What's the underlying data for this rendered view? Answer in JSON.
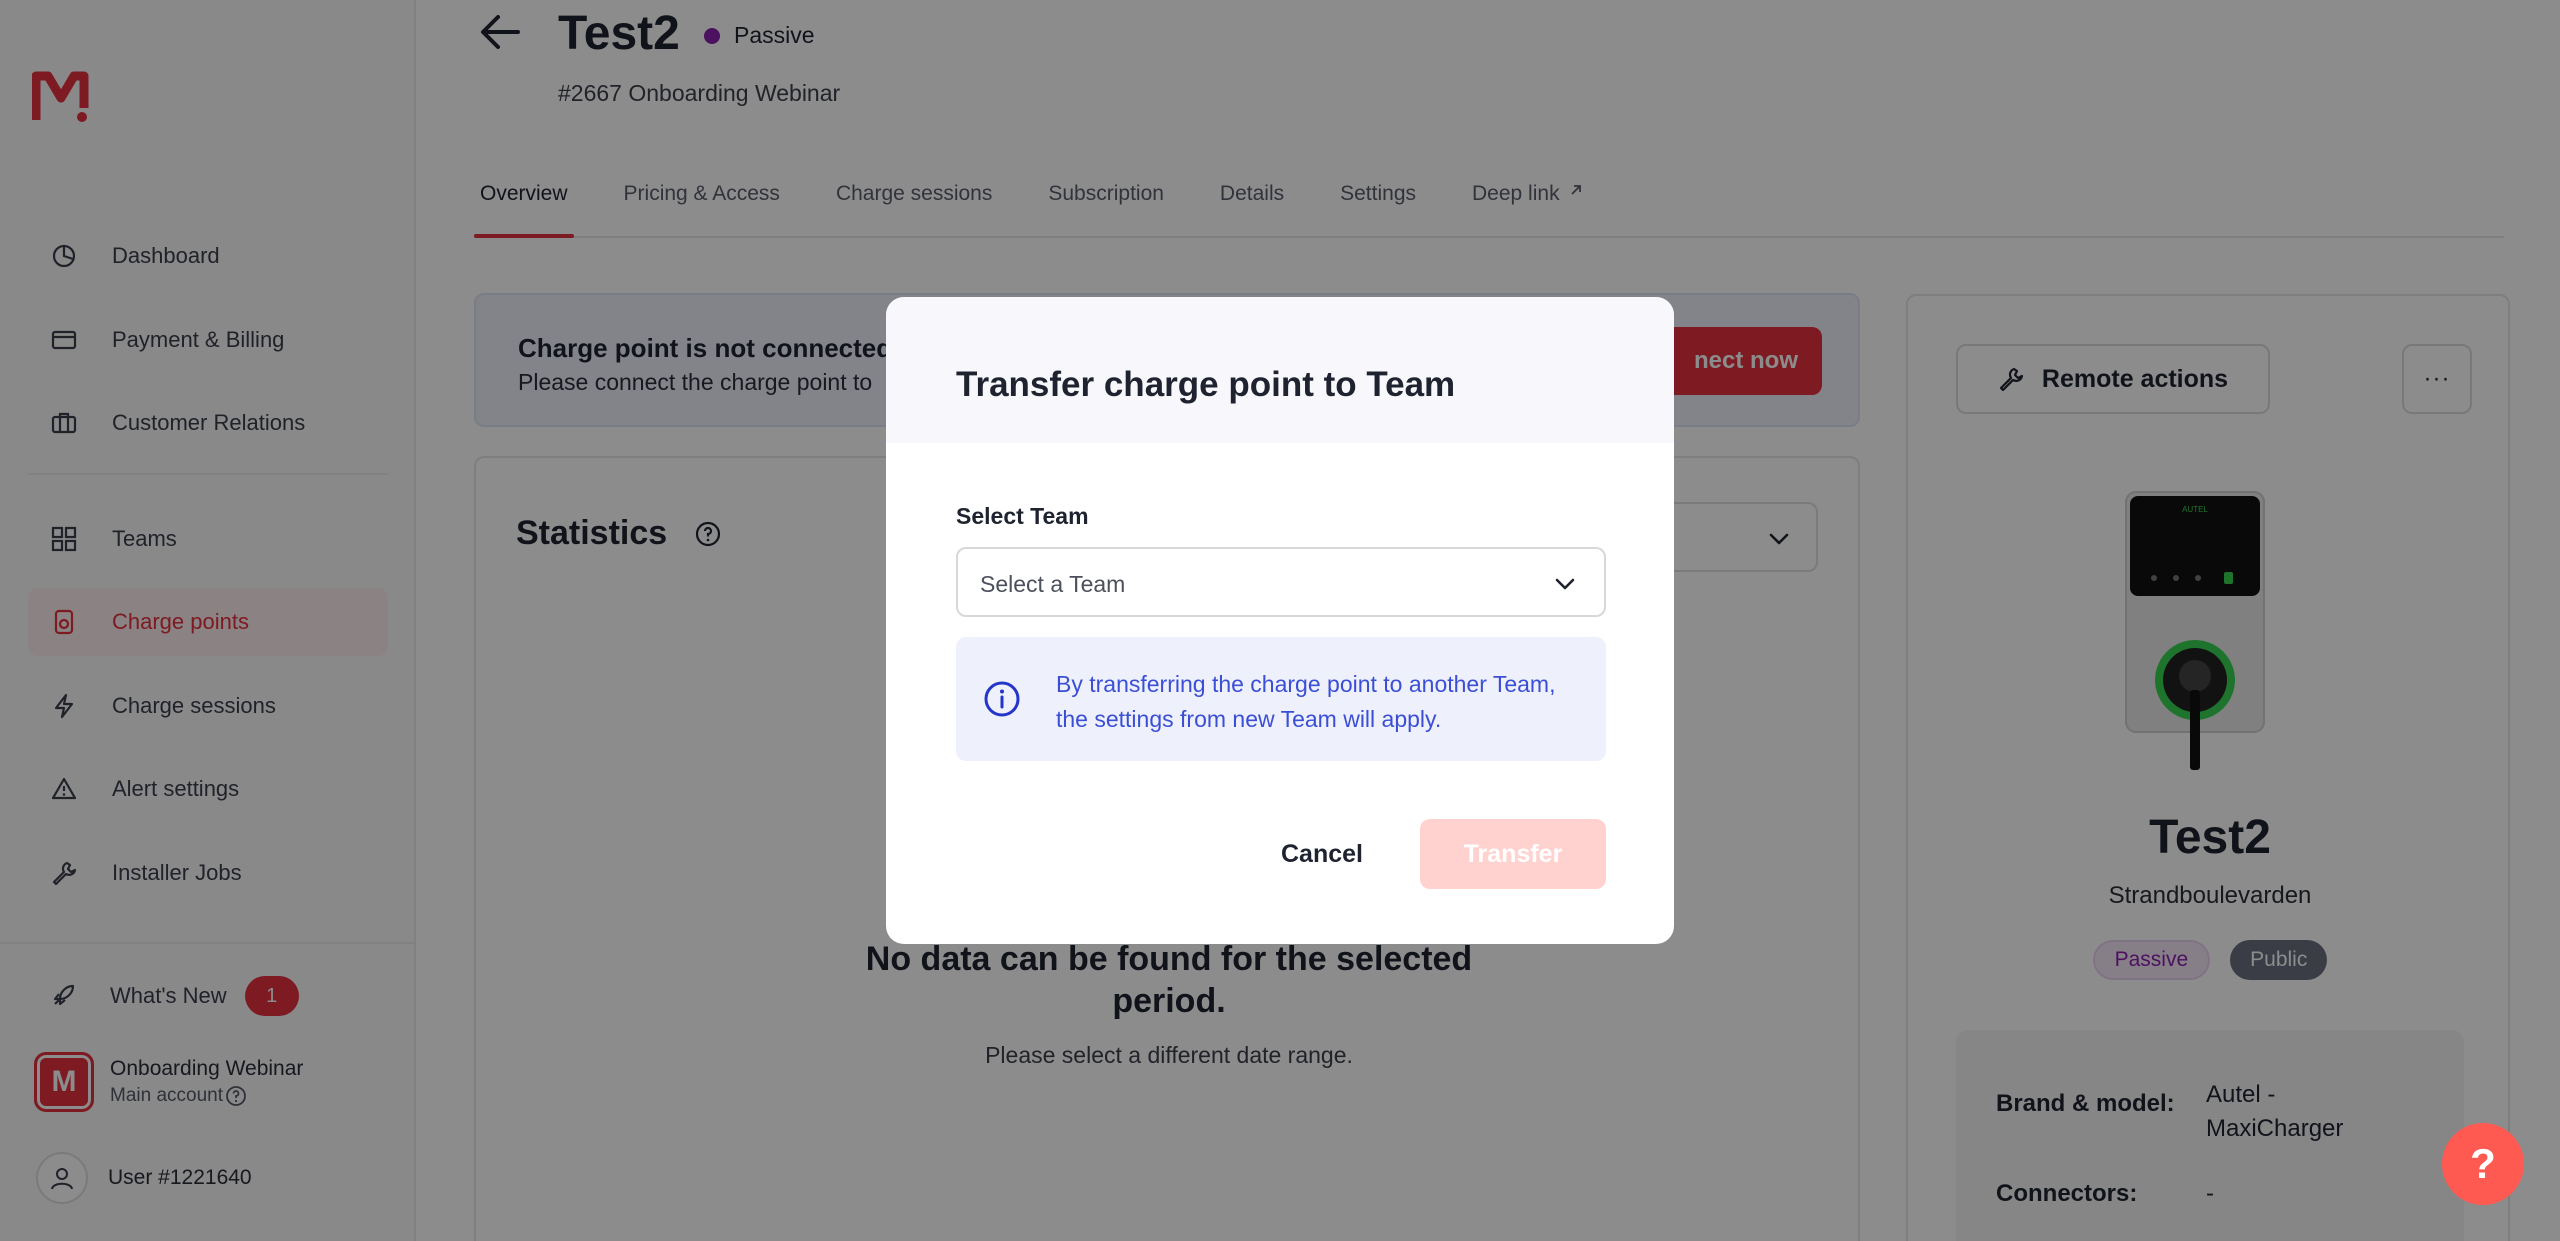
{
  "brand": {
    "logo_letter": "M",
    "accent": "#e3303f"
  },
  "sidebar": {
    "items": [
      {
        "label": "Dashboard",
        "icon": "pie-chart-icon"
      },
      {
        "label": "Payment & Billing",
        "icon": "credit-card-icon"
      },
      {
        "label": "Customer Relations",
        "icon": "briefcase-icon"
      },
      {
        "label": "Teams",
        "icon": "grid-icon"
      },
      {
        "label": "Charge points",
        "icon": "charge-point-icon",
        "active": true
      },
      {
        "label": "Charge sessions",
        "icon": "bolt-icon"
      },
      {
        "label": "Alert settings",
        "icon": "alert-triangle-icon"
      },
      {
        "label": "Installer Jobs",
        "icon": "wrench-icon"
      }
    ],
    "whats_new": {
      "label": "What's New",
      "count": "1"
    },
    "account": {
      "name": "Onboarding Webinar",
      "sub": "Main account",
      "avatar_letter": "M"
    },
    "user": {
      "label": "User #1221640"
    }
  },
  "header": {
    "title": "Test2",
    "status": "Passive",
    "subtitle": "#2667 Onboarding Webinar"
  },
  "tabs": [
    {
      "label": "Overview",
      "active": true
    },
    {
      "label": "Pricing & Access"
    },
    {
      "label": "Charge sessions"
    },
    {
      "label": "Subscription"
    },
    {
      "label": "Details"
    },
    {
      "label": "Settings"
    },
    {
      "label": "Deep link"
    }
  ],
  "alert": {
    "title": "Charge point is not connected",
    "text": "Please connect the charge point to",
    "button": "nect now"
  },
  "statistics": {
    "title": "Statistics",
    "nodata_title": "No data can be found for the selected period.",
    "nodata_sub": "Please select a different date range."
  },
  "right_panel": {
    "remote_actions": "Remote actions",
    "more": "···",
    "name": "Test2",
    "address": "Strandboulevarden",
    "pill_status": "Passive",
    "pill_visibility": "Public",
    "charger_brand_text": "AUTEL",
    "brand_model_label": "Brand & model:",
    "brand_model_value": "Autel - MaxiCharger",
    "connectors_label": "Connectors:",
    "connectors_value": "-"
  },
  "modal": {
    "title": "Transfer charge point to Team",
    "field_label": "Select Team",
    "placeholder": "Select a Team",
    "note": "By transferring the charge point to another Team, the settings from new Team will apply.",
    "cancel": "Cancel",
    "transfer": "Transfer"
  },
  "help_fab": "?"
}
